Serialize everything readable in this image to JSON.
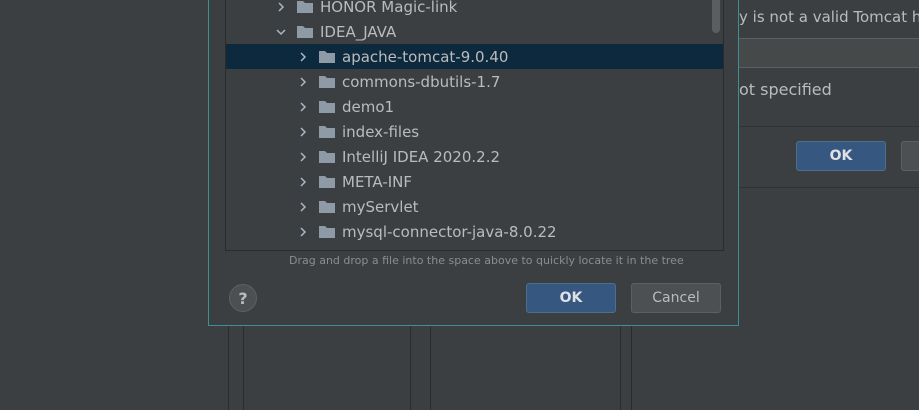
{
  "background_window": {
    "error_text": "y is not a valid Tomcat ho",
    "not_specified_text": "ot specified",
    "ok_label": "OK"
  },
  "chooser": {
    "tree": {
      "rows": [
        {
          "label": "HONOR Magic-link",
          "expanded": false,
          "selected": false,
          "level": 0
        },
        {
          "label": "IDEA_JAVA",
          "expanded": true,
          "selected": false,
          "level": 0
        },
        {
          "label": "apache-tomcat-9.0.40",
          "expanded": false,
          "selected": true,
          "level": 1
        },
        {
          "label": "commons-dbutils-1.7",
          "expanded": false,
          "selected": false,
          "level": 1
        },
        {
          "label": "demo1",
          "expanded": false,
          "selected": false,
          "level": 1
        },
        {
          "label": "index-files",
          "expanded": false,
          "selected": false,
          "level": 1
        },
        {
          "label": "IntelliJ IDEA 2020.2.2",
          "expanded": false,
          "selected": false,
          "level": 1
        },
        {
          "label": "META-INF",
          "expanded": false,
          "selected": false,
          "level": 1
        },
        {
          "label": "myServlet",
          "expanded": false,
          "selected": false,
          "level": 1
        },
        {
          "label": "mysql-connector-java-8.0.22",
          "expanded": false,
          "selected": false,
          "level": 1
        }
      ]
    },
    "hint": "Drag and drop a file into the space above to quickly locate it in the tree",
    "help_label": "?",
    "ok_label": "OK",
    "cancel_label": "Cancel"
  },
  "colors": {
    "accent_border": "#3d8f93",
    "selection": "#0d293e",
    "primary_button": "#365880",
    "folder": "#8e9ba6"
  },
  "icons": {
    "folder": "folder-icon",
    "collapsed": "chevron-right-icon",
    "expanded": "chevron-down-icon"
  }
}
